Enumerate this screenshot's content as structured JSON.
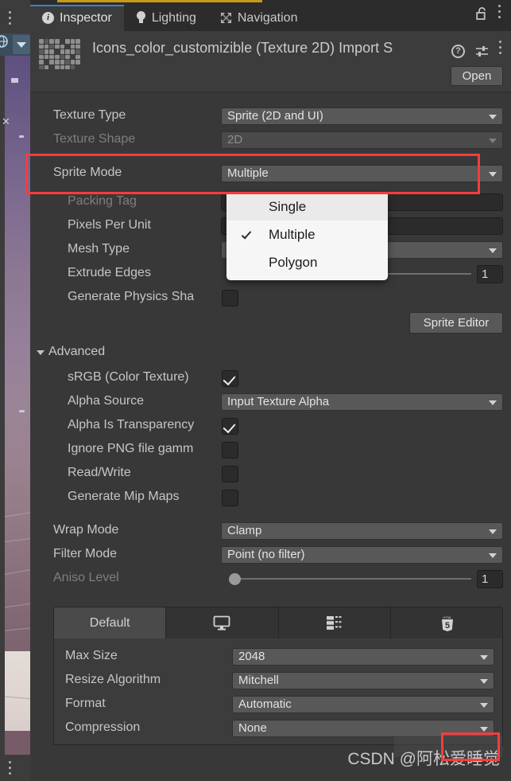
{
  "window": {
    "tabs": [
      {
        "label": "Inspector",
        "icon": "info-icon",
        "active": true
      },
      {
        "label": "Lighting",
        "icon": "bulb-icon",
        "active": false
      },
      {
        "label": "Navigation",
        "icon": "navigation-icon",
        "active": false
      }
    ],
    "lock_icon": "padlock-open-icon",
    "menu_icon": "kebab-menu-icon"
  },
  "asset": {
    "title": "Icons_color_customizible (Texture 2D) Import S",
    "thumbnail_icon": "icon-sheet-thumbnail",
    "help_icon": "help-icon",
    "preset_icon": "preset-settings-icon",
    "menu_icon": "kebab-menu-icon",
    "open_label": "Open"
  },
  "properties": {
    "texture_type": {
      "label": "Texture Type",
      "value": "Sprite (2D and UI)"
    },
    "texture_shape": {
      "label": "Texture Shape",
      "value": "2D",
      "disabled": true
    },
    "sprite_mode": {
      "label": "Sprite Mode",
      "value": "Multiple",
      "highlighted": true
    },
    "packing_tag": {
      "label": "Packing Tag",
      "value": "",
      "disabled": true
    },
    "pixels_per_unit": {
      "label": "Pixels Per Unit",
      "value": ""
    },
    "mesh_type": {
      "label": "Mesh Type",
      "value": ""
    },
    "extrude_edges": {
      "label": "Extrude Edges",
      "value": "1"
    },
    "generate_physics_shape": {
      "label": "Generate Physics Sha",
      "checked": false
    },
    "sprite_editor_label": "Sprite Editor"
  },
  "advanced": {
    "header": "Advanced",
    "srgb": {
      "label": "sRGB (Color Texture)",
      "checked": true
    },
    "alpha_source": {
      "label": "Alpha Source",
      "value": "Input Texture Alpha"
    },
    "alpha_is_transparency": {
      "label": "Alpha Is Transparency",
      "checked": true
    },
    "ignore_png_gamma": {
      "label": "Ignore PNG file gamm",
      "checked": false
    },
    "read_write": {
      "label": "Read/Write",
      "checked": false
    },
    "generate_mip_maps": {
      "label": "Generate Mip Maps",
      "checked": false
    }
  },
  "filtering": {
    "wrap_mode": {
      "label": "Wrap Mode",
      "value": "Clamp"
    },
    "filter_mode": {
      "label": "Filter Mode",
      "value": "Point (no filter)"
    },
    "aniso_level": {
      "label": "Aniso Level",
      "value": "1",
      "disabled": true
    }
  },
  "platform": {
    "tabs": [
      {
        "label": "Default",
        "icon": "",
        "active": true
      },
      {
        "label": "",
        "icon": "monitor-icon",
        "active": false
      },
      {
        "label": "",
        "icon": "android-icon",
        "active": false
      },
      {
        "label": "",
        "icon": "html5-icon",
        "active": false
      }
    ],
    "max_size": {
      "label": "Max Size",
      "value": "2048"
    },
    "resize_algorithm": {
      "label": "Resize Algorithm",
      "value": "Mitchell"
    },
    "format": {
      "label": "Format",
      "value": "Automatic"
    },
    "compression": {
      "label": "Compression",
      "value": "None"
    }
  },
  "dropdown": {
    "options": [
      {
        "label": "Single",
        "checked": false,
        "hover": true
      },
      {
        "label": "Multiple",
        "checked": true,
        "hover": false
      },
      {
        "label": "Polygon",
        "checked": false,
        "hover": false
      }
    ]
  },
  "watermark": {
    "text": "CSDN @阿松爱睡觉"
  },
  "colors": {
    "accent_blue": "#3b7fd4",
    "annotation_red": "#f53d3d",
    "panel_bg": "#383838",
    "field_bg": "#585858",
    "top_accent": "#c79a19"
  }
}
